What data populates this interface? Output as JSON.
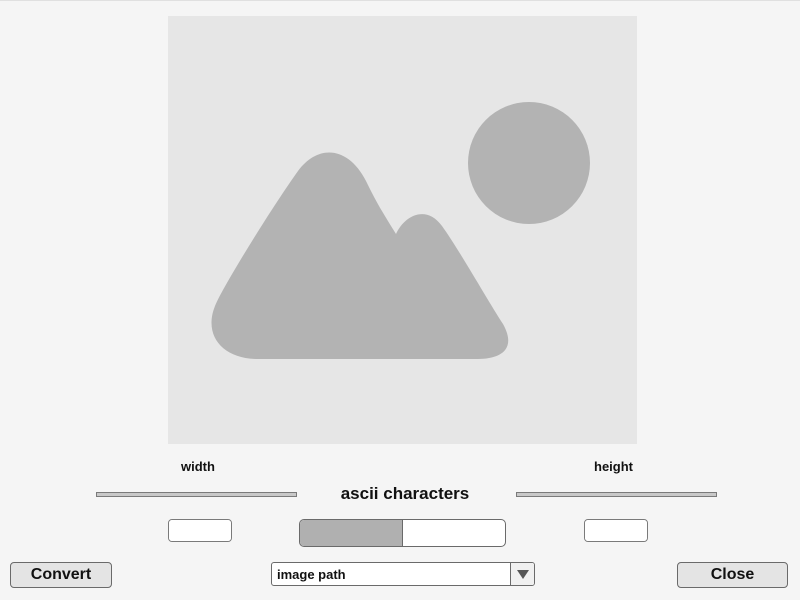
{
  "window": {
    "background": "#f5f5f5"
  },
  "preview": {
    "placeholder_icon": "image-placeholder-icon",
    "background": "#e6e6e6",
    "icon_color": "#b3b3b3"
  },
  "labels": {
    "width": "width",
    "height": "height",
    "ascii": "ascii characters"
  },
  "width_spinner": {
    "value": ""
  },
  "height_spinner": {
    "value": ""
  },
  "ascii_slider": {
    "value_fraction": 0.5
  },
  "buttons": {
    "convert": "Convert",
    "close": "Close"
  },
  "image_path_combo": {
    "value": "image path",
    "dropdown_icon": "triangle-down-icon"
  }
}
